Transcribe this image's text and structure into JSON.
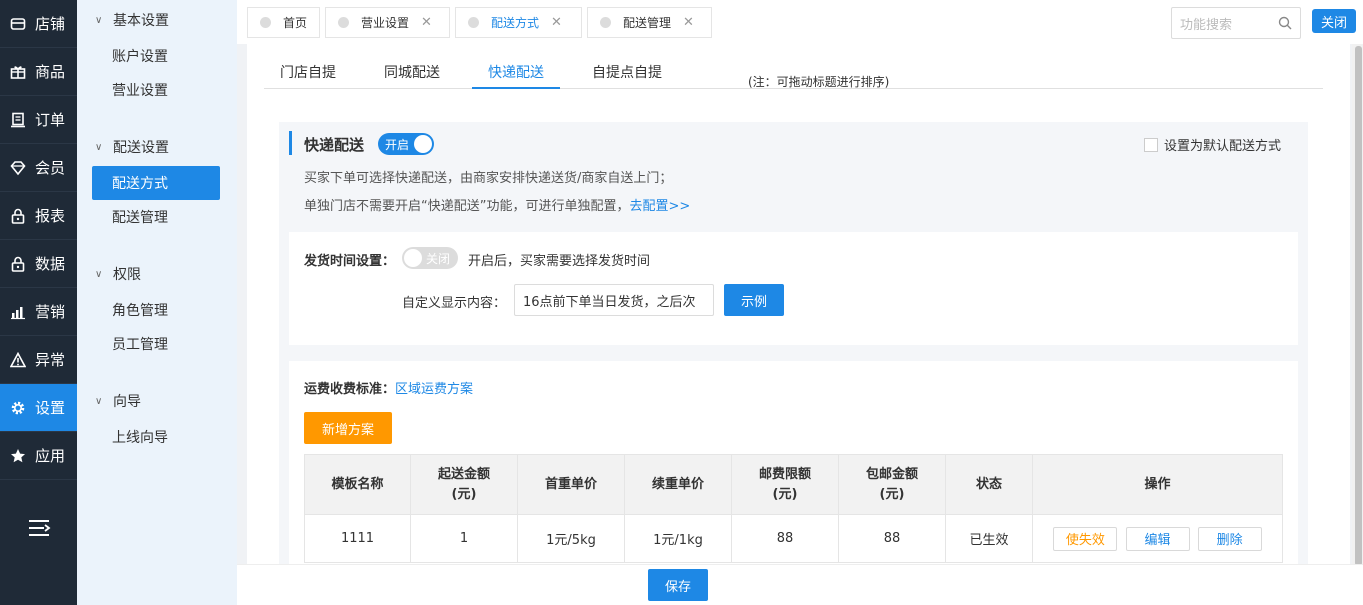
{
  "nav": {
    "items": [
      {
        "label": "店铺",
        "icon": "store-icon"
      },
      {
        "label": "商品",
        "icon": "gift-icon"
      },
      {
        "label": "订单",
        "icon": "order-icon"
      },
      {
        "label": "会员",
        "icon": "diamond-icon"
      },
      {
        "label": "报表",
        "icon": "lock-icon"
      },
      {
        "label": "数据",
        "icon": "lock-icon"
      },
      {
        "label": "营销",
        "icon": "bar-chart-icon"
      },
      {
        "label": "异常",
        "icon": "warning-icon"
      },
      {
        "label": "设置",
        "icon": "gear-icon"
      },
      {
        "label": "应用",
        "icon": "star-icon"
      }
    ],
    "active_index": 8
  },
  "subnav": {
    "groups": [
      {
        "title": "基本设置",
        "items": [
          "账户设置",
          "营业设置"
        ]
      },
      {
        "title": "配送设置",
        "items": [
          "配送方式",
          "配送管理"
        ]
      },
      {
        "title": "权限",
        "items": [
          "角色管理",
          "员工管理"
        ]
      },
      {
        "title": "向导",
        "items": [
          "上线向导"
        ]
      }
    ],
    "active_item": "配送方式"
  },
  "page_tabs": [
    {
      "label": "首页",
      "closable": false
    },
    {
      "label": "营业设置",
      "closable": true
    },
    {
      "label": "配送方式",
      "closable": true,
      "active": true
    },
    {
      "label": "配送管理",
      "closable": true
    }
  ],
  "search": {
    "placeholder": "功能搜索"
  },
  "close_label": "关闭",
  "main_tabs": [
    "门店自提",
    "同城配送",
    "快递配送",
    "自提点自提"
  ],
  "main_tab_active": "快递配送",
  "main_tab_note": "(注：可拖动标题进行排序)",
  "section": {
    "title": "快递配送",
    "switch_label": "开启",
    "default_label": "设置为默认配送方式",
    "desc1": "买家下单可选择快递配送，由商家安排快递送货/商家自送上门；",
    "desc2_prefix": "单独门店不需要开启“快递配送”功能，可进行单独配置，",
    "desc2_link": "去配置>>"
  },
  "shipping_time": {
    "label": "发货时间设置：",
    "switch_label": "关闭",
    "hint": "开启后，买家需要选择发货时间",
    "custom_label": "自定义显示内容：",
    "custom_value": "16点前下单当日发货，之后次",
    "example_label": "示例"
  },
  "fee": {
    "label": "运费收费标准：",
    "link": "区域运费方案",
    "add_label": "新增方案",
    "columns": [
      "模板名称",
      "起送金额\n(元)",
      "首重单价",
      "续重单价",
      "邮费限额\n(元)",
      "包邮金额\n(元)",
      "状态",
      "操作"
    ],
    "rows": [
      {
        "name": "1111",
        "min": "1",
        "first": "1元/5kg",
        "next": "1元/1kg",
        "limit": "88",
        "free": "88",
        "status": "已生效"
      }
    ],
    "ops": [
      "使失效",
      "编辑",
      "删除"
    ]
  },
  "save_label": "保存",
  "colors": {
    "primary": "#1e88e5",
    "nav_bg": "#1f2a37",
    "orange": "#ff9800"
  }
}
